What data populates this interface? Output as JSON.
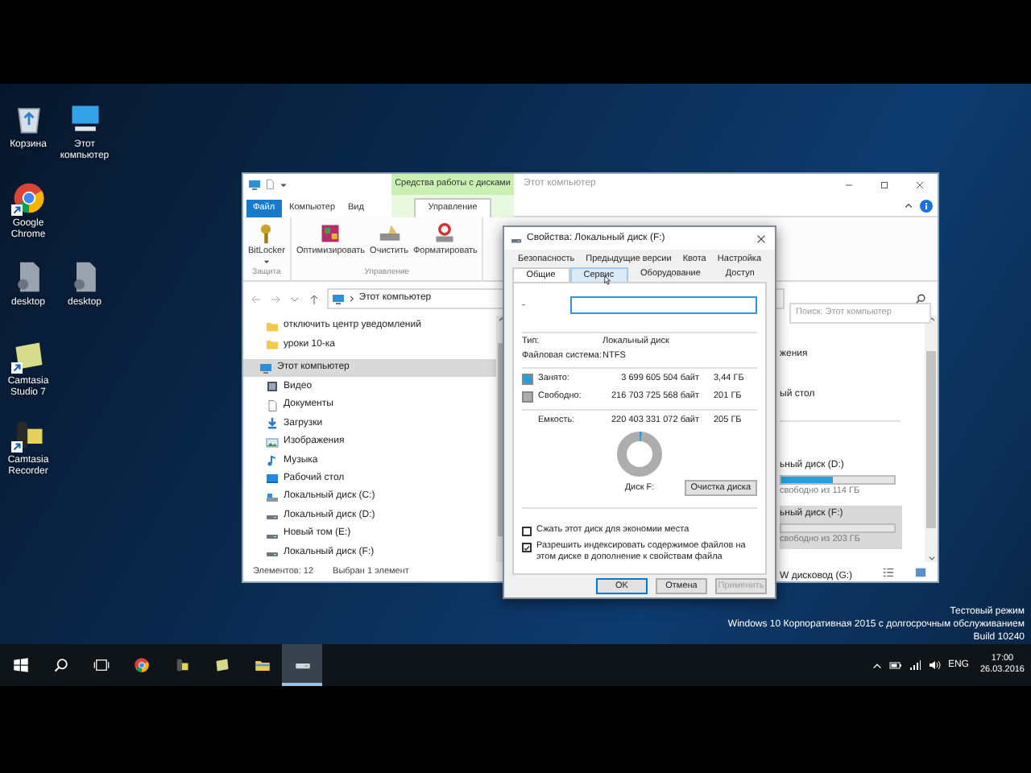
{
  "desktop_icon_rows": [
    [
      {
        "label": "Корзина",
        "kind": "recycle_bin",
        "shortcut": false
      },
      {
        "label": "Этот компьютер",
        "kind": "computer",
        "shortcut": false
      }
    ],
    [
      {
        "label": "Google Chrome",
        "kind": "chrome",
        "shortcut": true
      }
    ],
    [
      {
        "label": "desktop",
        "kind": "file",
        "shortcut": false
      },
      {
        "label": "desktop",
        "kind": "file",
        "shortcut": false
      }
    ],
    [
      {
        "label": "Camtasia Studio 7",
        "kind": "camtasia_studio",
        "shortcut": true
      }
    ],
    [
      {
        "label": "Camtasia Recorder",
        "kind": "camtasia_recorder",
        "shortcut": true
      }
    ]
  ],
  "explorer": {
    "title": "Этот компьютер",
    "contextual_group": "Средства работы с дисками",
    "tabs": [
      {
        "label": "Файл",
        "kind": "file_menu",
        "selected": false
      },
      {
        "label": "Компьютер",
        "kind": "tab",
        "selected": false
      },
      {
        "label": "Вид",
        "kind": "tab",
        "selected": false
      },
      {
        "label": "Управление",
        "kind": "contextual",
        "selected": true
      }
    ],
    "ribbon_groups": [
      {
        "label": "Защита",
        "buttons": [
          {
            "label": "BitLocker",
            "kind": "bitlocker",
            "has_menu": true
          }
        ]
      },
      {
        "label": "Управление",
        "buttons": [
          {
            "label": "Оптимизировать",
            "kind": "optimize",
            "has_menu": false
          },
          {
            "label": "Очистить",
            "kind": "cleanup",
            "has_menu": false
          },
          {
            "label": "Форматировать",
            "kind": "format",
            "has_menu": false
          }
        ]
      }
    ],
    "address": "Этот компьютер",
    "search": {
      "placeholder": "Поиск: Этот компьютер"
    },
    "quick_access": [
      {
        "label": "отключить центр уведомлений",
        "kind": "folder",
        "selected": false
      },
      {
        "label": "уроки 10-ка",
        "kind": "folder",
        "selected": false
      }
    ],
    "tree": [
      {
        "label": "Этот компьютер",
        "kind": "computer",
        "selected": true,
        "children": [
          {
            "label": "Видео",
            "kind": "video",
            "selected": false
          },
          {
            "label": "Документы",
            "kind": "documents",
            "selected": false
          },
          {
            "label": "Загрузки",
            "kind": "downloads",
            "selected": false
          },
          {
            "label": "Изображения",
            "kind": "pictures",
            "selected": false
          },
          {
            "label": "Музыка",
            "kind": "music",
            "selected": false
          },
          {
            "label": "Рабочий стол",
            "kind": "desktop",
            "selected": false
          },
          {
            "label": "Локальный диск (C:)",
            "kind": "system_drive",
            "selected": false
          },
          {
            "label": "Локальный диск (D:)",
            "kind": "drive",
            "selected": false
          },
          {
            "label": "Новый том (E:)",
            "kind": "drive",
            "selected": false
          },
          {
            "label": "Локальный диск (F:)",
            "kind": "drive",
            "selected": false
          }
        ]
      }
    ],
    "content_items": [
      {
        "name": "жения",
        "kind": "folder",
        "selected": false
      },
      {
        "name": "ый стол",
        "kind": "folder",
        "selected": false
      },
      {
        "name": "ьный диск (D:)",
        "kind": "drive",
        "selected": false,
        "level": 0.45,
        "free": "свободно из 114 ГБ"
      },
      {
        "name": "ьный диск (F:)",
        "kind": "drive",
        "selected": true,
        "free": "свободно из 203 ГБ"
      },
      {
        "name": "W дисковод (G:)",
        "kind": "optical",
        "selected": false
      }
    ],
    "status_bar": {
      "count": "Элементов: 12",
      "selection": "Выбран 1 элемент"
    }
  },
  "dialog": {
    "title": "Свойства: Локальный диск (F:)",
    "tab_rows": [
      [
        {
          "label": "Безопасность",
          "selected": false,
          "hovered": false
        },
        {
          "label": "Предыдущие версии",
          "selected": false,
          "hovered": false
        },
        {
          "label": "Квота",
          "selected": false,
          "hovered": false
        },
        {
          "label": "Настройка",
          "selected": false,
          "hovered": false
        }
      ],
      [
        {
          "label": "Общие",
          "selected": true,
          "hovered": false
        },
        {
          "label": "Сервис",
          "selected": false,
          "hovered": true
        },
        {
          "label": "Оборудование",
          "selected": false,
          "hovered": false
        },
        {
          "label": "Доступ",
          "selected": false,
          "hovered": false
        }
      ]
    ],
    "info": [
      {
        "label": "Тип:",
        "value": "Локальный диск"
      },
      {
        "label": "Файловая система:",
        "value": "NTFS"
      }
    ],
    "usage": [
      {
        "label": "Занято:",
        "bytes": "3 699 605 504 байт",
        "size": "3,44 ГБ",
        "color": "#26a0da"
      },
      {
        "label": "Свободно:",
        "bytes": "216 703 725 568 байт",
        "size": "201 ГБ",
        "color": "#adadad"
      }
    ],
    "capacity": {
      "label": "Емкость:",
      "bytes": "220 403 331 072 байт",
      "size": "205 ГБ"
    },
    "chart": {
      "level": 0.017,
      "caption": "Диск F:"
    },
    "cleanup_button": "Очистка диска",
    "options": [
      {
        "label": "Сжать этот диск для экономии места",
        "checked": false
      },
      {
        "label": "Разрешить индексировать содержимое файлов на этом диске в дополнение к свойствам файла",
        "checked": true
      }
    ],
    "buttons": [
      {
        "label": "OK",
        "default": true,
        "disabled": false
      },
      {
        "label": "Отмена",
        "default": false,
        "disabled": false
      },
      {
        "label": "Применить",
        "default": false,
        "disabled": true
      }
    ]
  },
  "desktop_watermark": [
    "Тестовый режим",
    "Windows 10 Корпоративная 2015 с долгосрочным обслуживанием",
    "Build 10240"
  ],
  "taskbar": {
    "items": [
      {
        "kind": "start",
        "selected": false
      },
      {
        "kind": "search",
        "selected": false
      },
      {
        "kind": "task_view",
        "selected": false
      },
      {
        "kind": "chrome",
        "selected": false
      },
      {
        "kind": "camtasia_recorder",
        "selected": false
      },
      {
        "kind": "camtasia_studio",
        "selected": false
      },
      {
        "kind": "explorer",
        "selected": false
      },
      {
        "kind": "drive",
        "selected": true
      }
    ],
    "tray": {
      "language": "ENG",
      "time": "17:00",
      "date": "26.03.2016"
    }
  }
}
